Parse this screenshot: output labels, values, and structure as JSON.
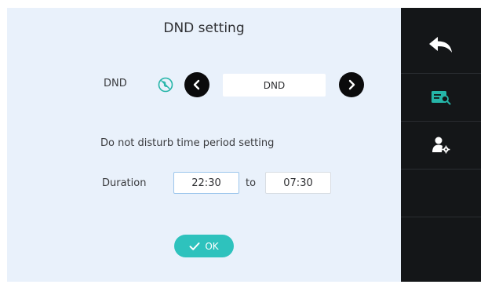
{
  "screen": {
    "title": "DND setting"
  },
  "dnd": {
    "label": "DND",
    "status_icon": "dnd-status-icon",
    "mode_value": "DND",
    "prev_icon": "chevron-left-icon",
    "next_icon": "chevron-right-icon"
  },
  "period": {
    "section_label": "Do not disturb time period setting",
    "duration_label": "Duration",
    "start_time": "22:30",
    "separator": "to",
    "end_time": "07:30"
  },
  "actions": {
    "ok_label": "OK",
    "ok_icon": "check-icon"
  },
  "sidebar": {
    "items": [
      {
        "icon": "back-arrow-icon"
      },
      {
        "icon": "card-search-icon"
      },
      {
        "icon": "user-settings-icon"
      }
    ]
  },
  "colors": {
    "panel_background": "#e9f1fb",
    "sidebar_background": "#141618",
    "accent": "#2ec2bd",
    "icon_accent": "#25b5a8"
  }
}
